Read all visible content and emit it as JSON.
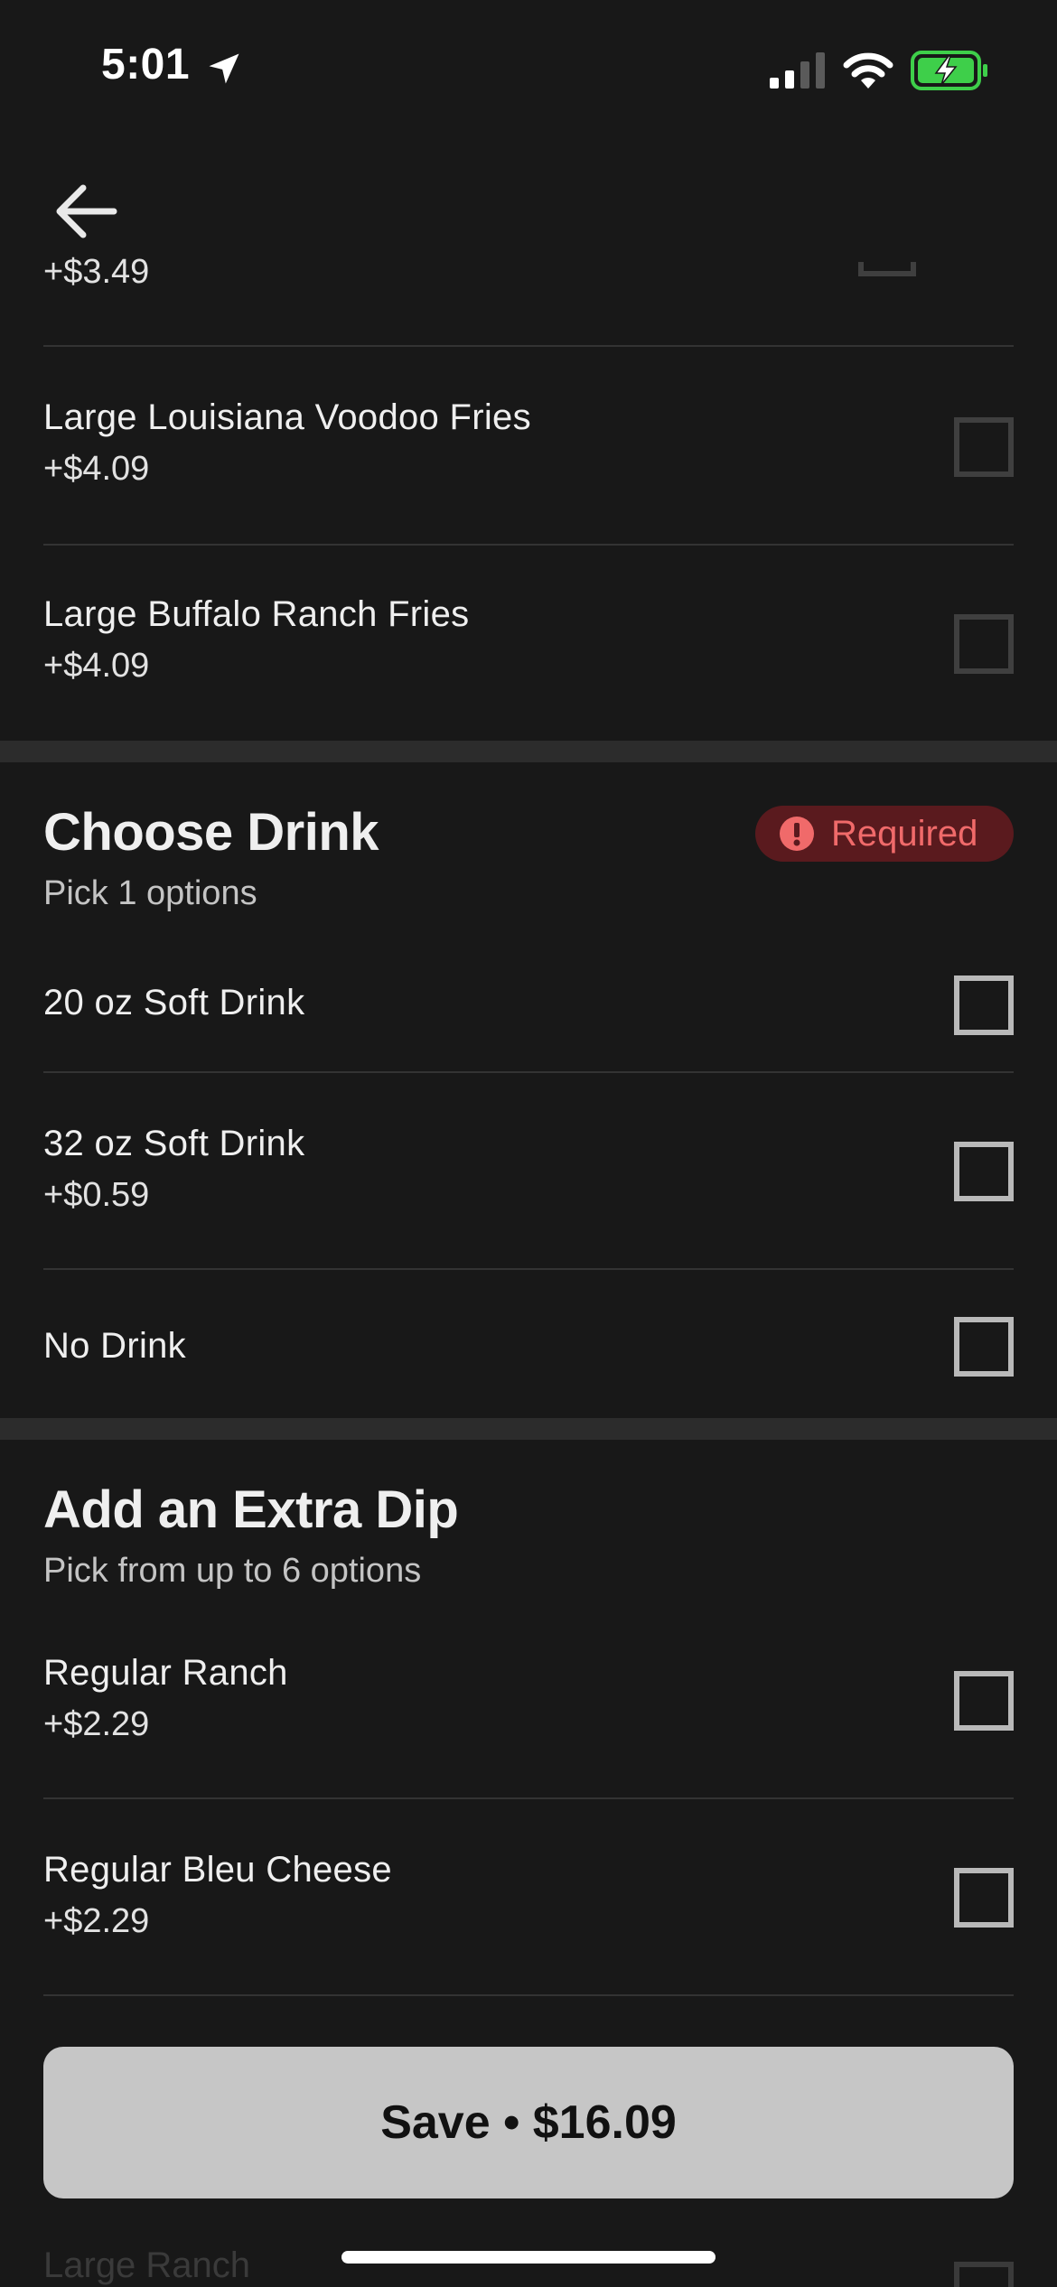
{
  "status_bar": {
    "time": "5:01",
    "icons": [
      "location-arrow-icon",
      "signal-icon",
      "wifi-icon",
      "battery-charging-icon"
    ],
    "battery_color": "#3ecf4a"
  },
  "top_bar": {
    "back_icon": "arrow-left-icon"
  },
  "partial_item": {
    "price": "+$3.49"
  },
  "fries_items": [
    {
      "name": "Large Louisiana Voodoo Fries",
      "price": "+$4.09"
    },
    {
      "name": "Large Buffalo Ranch Fries",
      "price": "+$4.09"
    }
  ],
  "drink_section": {
    "title": "Choose Drink",
    "subtitle": "Pick 1 options",
    "badge": "Required",
    "badge_color": "#f06a6a",
    "options": [
      {
        "name": "20 oz Soft Drink",
        "price": ""
      },
      {
        "name": "32 oz Soft Drink",
        "price": "+$0.59"
      },
      {
        "name": "No Drink",
        "price": ""
      }
    ]
  },
  "dip_section": {
    "title": "Add an Extra Dip",
    "subtitle": "Pick from up to 6 options",
    "options": [
      {
        "name": "Regular Ranch",
        "price": "+$2.29"
      },
      {
        "name": "Regular Bleu Cheese",
        "price": "+$2.29"
      }
    ],
    "peek_item": "Large Ranch"
  },
  "save_button": {
    "label": "Save • $16.09"
  }
}
